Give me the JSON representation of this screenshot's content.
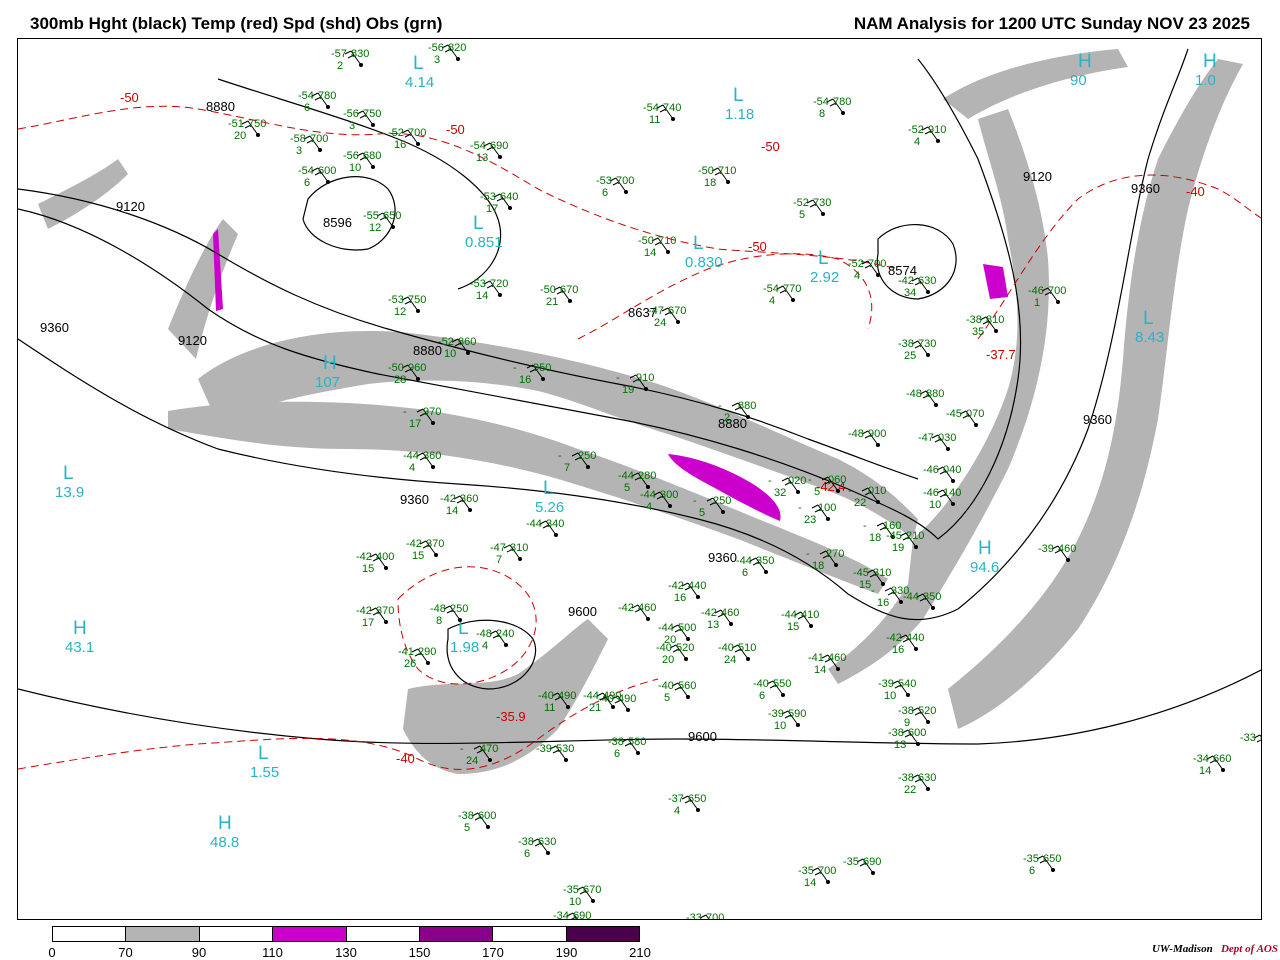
{
  "header": {
    "left_title": "300mb Hght (black) Temp (red) Spd (shd) Obs (grn)",
    "right_title": "NAM Analysis for 1200 UTC Sunday  NOV 23 2025"
  },
  "colorbar": {
    "ticks": [
      "0",
      "70",
      "90",
      "110",
      "130",
      "150",
      "170",
      "190",
      "210"
    ],
    "segments": [
      {
        "from": 0,
        "to": 70,
        "color": "#ffffff"
      },
      {
        "from": 70,
        "to": 90,
        "color": "#b4b4b4"
      },
      {
        "from": 90,
        "to": 110,
        "color": "#ffffff"
      },
      {
        "from": 110,
        "to": 130,
        "color": "#cc00cc"
      },
      {
        "from": 130,
        "to": 150,
        "color": "#ffffff"
      },
      {
        "from": 150,
        "to": 170,
        "color": "#8a008a"
      },
      {
        "from": 170,
        "to": 190,
        "color": "#ffffff"
      },
      {
        "from": 190,
        "to": 210,
        "color": "#4a004a"
      }
    ]
  },
  "credit": {
    "org": "UW-Madison",
    "dept": "Dept of AOS"
  },
  "colors": {
    "height": "#000000",
    "temperature": "#cc0000",
    "speed_shade": "#b4b4b4",
    "speed_shade_high": "#cc00cc",
    "obs": "#007000",
    "centers": "#2ab3c3"
  },
  "pressure_centers": [
    {
      "type": "L",
      "value": "4.14"
    },
    {
      "type": "L",
      "value": "1.18"
    },
    {
      "type": "L",
      "value": "0.851"
    },
    {
      "type": "L",
      "value": "0.830"
    },
    {
      "type": "L",
      "value": "2.92"
    },
    {
      "type": "L",
      "value": "8.43"
    },
    {
      "type": "H",
      "value": "107"
    },
    {
      "type": "L",
      "value": "13.9"
    },
    {
      "type": "L",
      "value": "5.26"
    },
    {
      "type": "H",
      "value": "43.1"
    },
    {
      "type": "L",
      "value": "1.98"
    },
    {
      "type": "L",
      "value": "1.55"
    },
    {
      "type": "H",
      "value": "48.8"
    },
    {
      "type": "H",
      "value": "94.6"
    },
    {
      "type": "H",
      "value": "90"
    },
    {
      "type": "H",
      "value": "1.0"
    }
  ],
  "height_labels": [
    "8880",
    "9120",
    "8596",
    "9360",
    "9120",
    "8880",
    "8637",
    "8574",
    "8880",
    "9120",
    "9360",
    "9360",
    "9360",
    "9360",
    "9600",
    "9600"
  ],
  "temp_labels": [
    "-50",
    "-50",
    "-50",
    "-50",
    "-40",
    "-40",
    "-35.9",
    "-37.7",
    "-42.4"
  ],
  "observations": [
    {
      "t": "-57",
      "h": "830",
      "d": "2"
    },
    {
      "t": "-56",
      "h": "820",
      "d": "3"
    },
    {
      "t": "-54",
      "h": "780",
      "d": "6"
    },
    {
      "t": "-51",
      "h": "750",
      "d": "20"
    },
    {
      "t": "-56",
      "h": "750",
      "d": "3"
    },
    {
      "t": "-58",
      "h": "700",
      "d": "3"
    },
    {
      "t": "-56",
      "h": "680",
      "d": "10"
    },
    {
      "t": "-54",
      "h": "600",
      "d": "6"
    },
    {
      "t": "-52",
      "h": "700",
      "d": "16"
    },
    {
      "t": "-54",
      "h": "690",
      "d": "13"
    },
    {
      "t": "-54",
      "h": "740",
      "d": "11"
    },
    {
      "t": "-54",
      "h": "780",
      "d": "8"
    },
    {
      "t": "-52",
      "h": "910",
      "d": "4"
    },
    {
      "t": "-53",
      "h": "700",
      "d": "6"
    },
    {
      "t": "-50",
      "h": "710",
      "d": "18"
    },
    {
      "t": "-52",
      "h": "730",
      "d": "5"
    },
    {
      "t": "-55",
      "h": "650",
      "d": "12"
    },
    {
      "t": "-53",
      "h": "640",
      "d": "17"
    },
    {
      "t": "-50",
      "h": "710",
      "d": "14"
    },
    {
      "t": "-52",
      "h": "700",
      "d": "4"
    },
    {
      "t": "-42",
      "h": "630",
      "d": "34"
    },
    {
      "t": "-46",
      "h": "700",
      "d": "1"
    },
    {
      "t": "-53",
      "h": "720",
      "d": "14"
    },
    {
      "t": "-50",
      "h": "670",
      "d": "21"
    },
    {
      "t": "-47",
      "h": "670",
      "d": "24"
    },
    {
      "t": "-54",
      "h": "770",
      "d": "4"
    },
    {
      "t": "-53",
      "h": "750",
      "d": "12"
    },
    {
      "t": "-38",
      "h": "810",
      "d": "35"
    },
    {
      "t": "-52",
      "h": "860",
      "d": "10"
    },
    {
      "t": "-38",
      "h": "730",
      "d": "25"
    },
    {
      "t": "-50",
      "h": "960",
      "d": "28"
    },
    {
      "t": "-",
      "h": "950",
      "d": "16"
    },
    {
      "t": "-",
      "h": "910",
      "d": "19"
    },
    {
      "t": "-",
      "h": "880",
      "d": "2"
    },
    {
      "t": "-48",
      "h": "880",
      "d": ""
    },
    {
      "t": "-",
      "h": "970",
      "d": "17"
    },
    {
      "t": "-48",
      "h": "900",
      "d": ""
    },
    {
      "t": "-45",
      "h": "070",
      "d": ""
    },
    {
      "t": "-47",
      "h": "030",
      "d": ""
    },
    {
      "t": "-",
      "h": "060",
      "d": "5"
    },
    {
      "t": "-46",
      "h": "040",
      "d": ""
    },
    {
      "t": "-44",
      "h": "360",
      "d": "4"
    },
    {
      "t": "-",
      "h": "250",
      "d": "7"
    },
    {
      "t": "-42",
      "h": "360",
      "d": "14"
    },
    {
      "t": "-44",
      "h": "280",
      "d": "5"
    },
    {
      "t": "-44",
      "h": "300",
      "d": "4"
    },
    {
      "t": "-",
      "h": "250",
      "d": "5"
    },
    {
      "t": "-",
      "h": "020",
      "d": "32"
    },
    {
      "t": "-",
      "h": "100",
      "d": "23"
    },
    {
      "t": "-46",
      "h": "140",
      "d": "10"
    },
    {
      "t": "-",
      "h": "010",
      "d": "22"
    },
    {
      "t": "-",
      "h": "160",
      "d": "18"
    },
    {
      "t": "-45",
      "h": "210",
      "d": "19"
    },
    {
      "t": "-44",
      "h": "340",
      "d": ""
    },
    {
      "t": "-42",
      "h": "370",
      "d": "15"
    },
    {
      "t": "-42",
      "h": "400",
      "d": "15"
    },
    {
      "t": "-47",
      "h": "310",
      "d": "7"
    },
    {
      "t": "-44",
      "h": "350",
      "d": "6"
    },
    {
      "t": "-",
      "h": "270",
      "d": "18"
    },
    {
      "t": "-45",
      "h": "310",
      "d": "15"
    },
    {
      "t": "-",
      "h": "330",
      "d": "16"
    },
    {
      "t": "-44",
      "h": "350",
      "d": ""
    },
    {
      "t": "-39",
      "h": "460",
      "d": ""
    },
    {
      "t": "-42",
      "h": "370",
      "d": "17"
    },
    {
      "t": "-48",
      "h": "250",
      "d": "8"
    },
    {
      "t": "-42",
      "h": "460",
      "d": ""
    },
    {
      "t": "-42",
      "h": "440",
      "d": "16"
    },
    {
      "t": "-42",
      "h": "460",
      "d": "13"
    },
    {
      "t": "-44",
      "h": "410",
      "d": "15"
    },
    {
      "t": "-42",
      "h": "440",
      "d": "16"
    },
    {
      "t": "-48",
      "h": "240",
      "d": "4"
    },
    {
      "t": "-44",
      "h": "500",
      "d": "20"
    },
    {
      "t": "-40",
      "h": "520",
      "d": "20"
    },
    {
      "t": "-40",
      "h": "510",
      "d": "24"
    },
    {
      "t": "-40",
      "h": "490",
      "d": "11"
    },
    {
      "t": "-41",
      "h": "460",
      "d": "14"
    },
    {
      "t": "-41",
      "h": "290",
      "d": "26"
    },
    {
      "t": "-40",
      "h": "490",
      "d": ""
    },
    {
      "t": "-44",
      "h": "490",
      "d": "21"
    },
    {
      "t": "-40",
      "h": "560",
      "d": "5"
    },
    {
      "t": "-40",
      "h": "550",
      "d": "6"
    },
    {
      "t": "-39",
      "h": "540",
      "d": "10"
    },
    {
      "t": "-38",
      "h": "520",
      "d": "9"
    },
    {
      "t": "-39",
      "h": "590",
      "d": "10"
    },
    {
      "t": "-38",
      "h": "600",
      "d": "13"
    },
    {
      "t": "-",
      "h": "470",
      "d": "24"
    },
    {
      "t": "-39",
      "h": "530",
      "d": ""
    },
    {
      "t": "-38",
      "h": "580",
      "d": "6"
    },
    {
      "t": "-38",
      "h": "630",
      "d": "22"
    },
    {
      "t": "-34",
      "h": "660",
      "d": "14"
    },
    {
      "t": "-33",
      "h": "6",
      "d": ""
    },
    {
      "t": "-38",
      "h": "600",
      "d": "5"
    },
    {
      "t": "-37",
      "h": "650",
      "d": "4"
    },
    {
      "t": "-38",
      "h": "630",
      "d": "6"
    },
    {
      "t": "-35",
      "h": "650",
      "d": "6"
    },
    {
      "t": "-35",
      "h": "690",
      "d": ""
    },
    {
      "t": "-35",
      "h": "700",
      "d": "14"
    },
    {
      "t": "-35",
      "h": "670",
      "d": "10"
    },
    {
      "t": "-34",
      "h": "690",
      "d": ""
    },
    {
      "t": "-33",
      "h": "700",
      "d": ""
    }
  ]
}
